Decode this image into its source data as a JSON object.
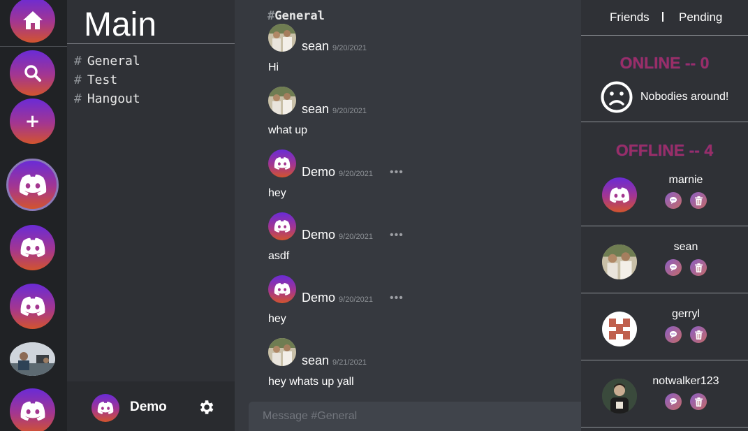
{
  "rail": {
    "items": [
      {
        "icon": "home-icon"
      },
      {
        "icon": "search-icon"
      },
      {
        "icon": "plus-icon",
        "label": "+"
      },
      {
        "icon": "discord-logo-icon",
        "active": true
      },
      {
        "icon": "discord-logo-icon"
      },
      {
        "icon": "discord-logo-icon"
      },
      {
        "icon": "office-photo"
      },
      {
        "icon": "discord-logo-icon"
      }
    ]
  },
  "server": {
    "title": "Main",
    "channels": [
      {
        "hash": "#",
        "name": "General"
      },
      {
        "hash": "#",
        "name": "Test"
      },
      {
        "hash": "#",
        "name": "Hangout"
      }
    ]
  },
  "user_panel": {
    "name": "Demo",
    "settings_icon": "gear-icon"
  },
  "chat": {
    "header_hash": "#",
    "channel": "General",
    "messages": [
      {
        "author": "sean",
        "date": "9/20/2021",
        "text": "Hi",
        "avatar": "sean-photo"
      },
      {
        "author": "sean",
        "date": "9/20/2021",
        "text": "what up",
        "avatar": "sean-photo"
      },
      {
        "author": "Demo",
        "date": "9/20/2021",
        "text": "hey",
        "avatar": "discord-logo-icon",
        "more": "•••"
      },
      {
        "author": "Demo",
        "date": "9/20/2021",
        "text": "asdf",
        "avatar": "discord-logo-icon",
        "more": "•••"
      },
      {
        "author": "Demo",
        "date": "9/20/2021",
        "text": "hey",
        "avatar": "discord-logo-icon",
        "more": "•••"
      },
      {
        "author": "sean",
        "date": "9/21/2021",
        "text": "hey whats up yall",
        "avatar": "sean-photo"
      }
    ],
    "composer_placeholder": "Message #General"
  },
  "friends": {
    "tabs": {
      "friends": "Friends",
      "pending": "Pending"
    },
    "online_title": "ONLINE -- 0",
    "empty_text": "Nobodies around!",
    "offline_title": "OFFLINE -- 4",
    "list": [
      {
        "name": "marnie",
        "avatar": "discord-logo-icon"
      },
      {
        "name": "sean",
        "avatar": "sean-photo"
      },
      {
        "name": "gerryl",
        "avatar": "gerryl-logo"
      },
      {
        "name": "notwalker123",
        "avatar": "walker-photo"
      }
    ]
  },
  "colors": {
    "accent_purple": "#6a2bd6",
    "accent_orange": "#d2542e",
    "section_title": "#9b2f63"
  }
}
